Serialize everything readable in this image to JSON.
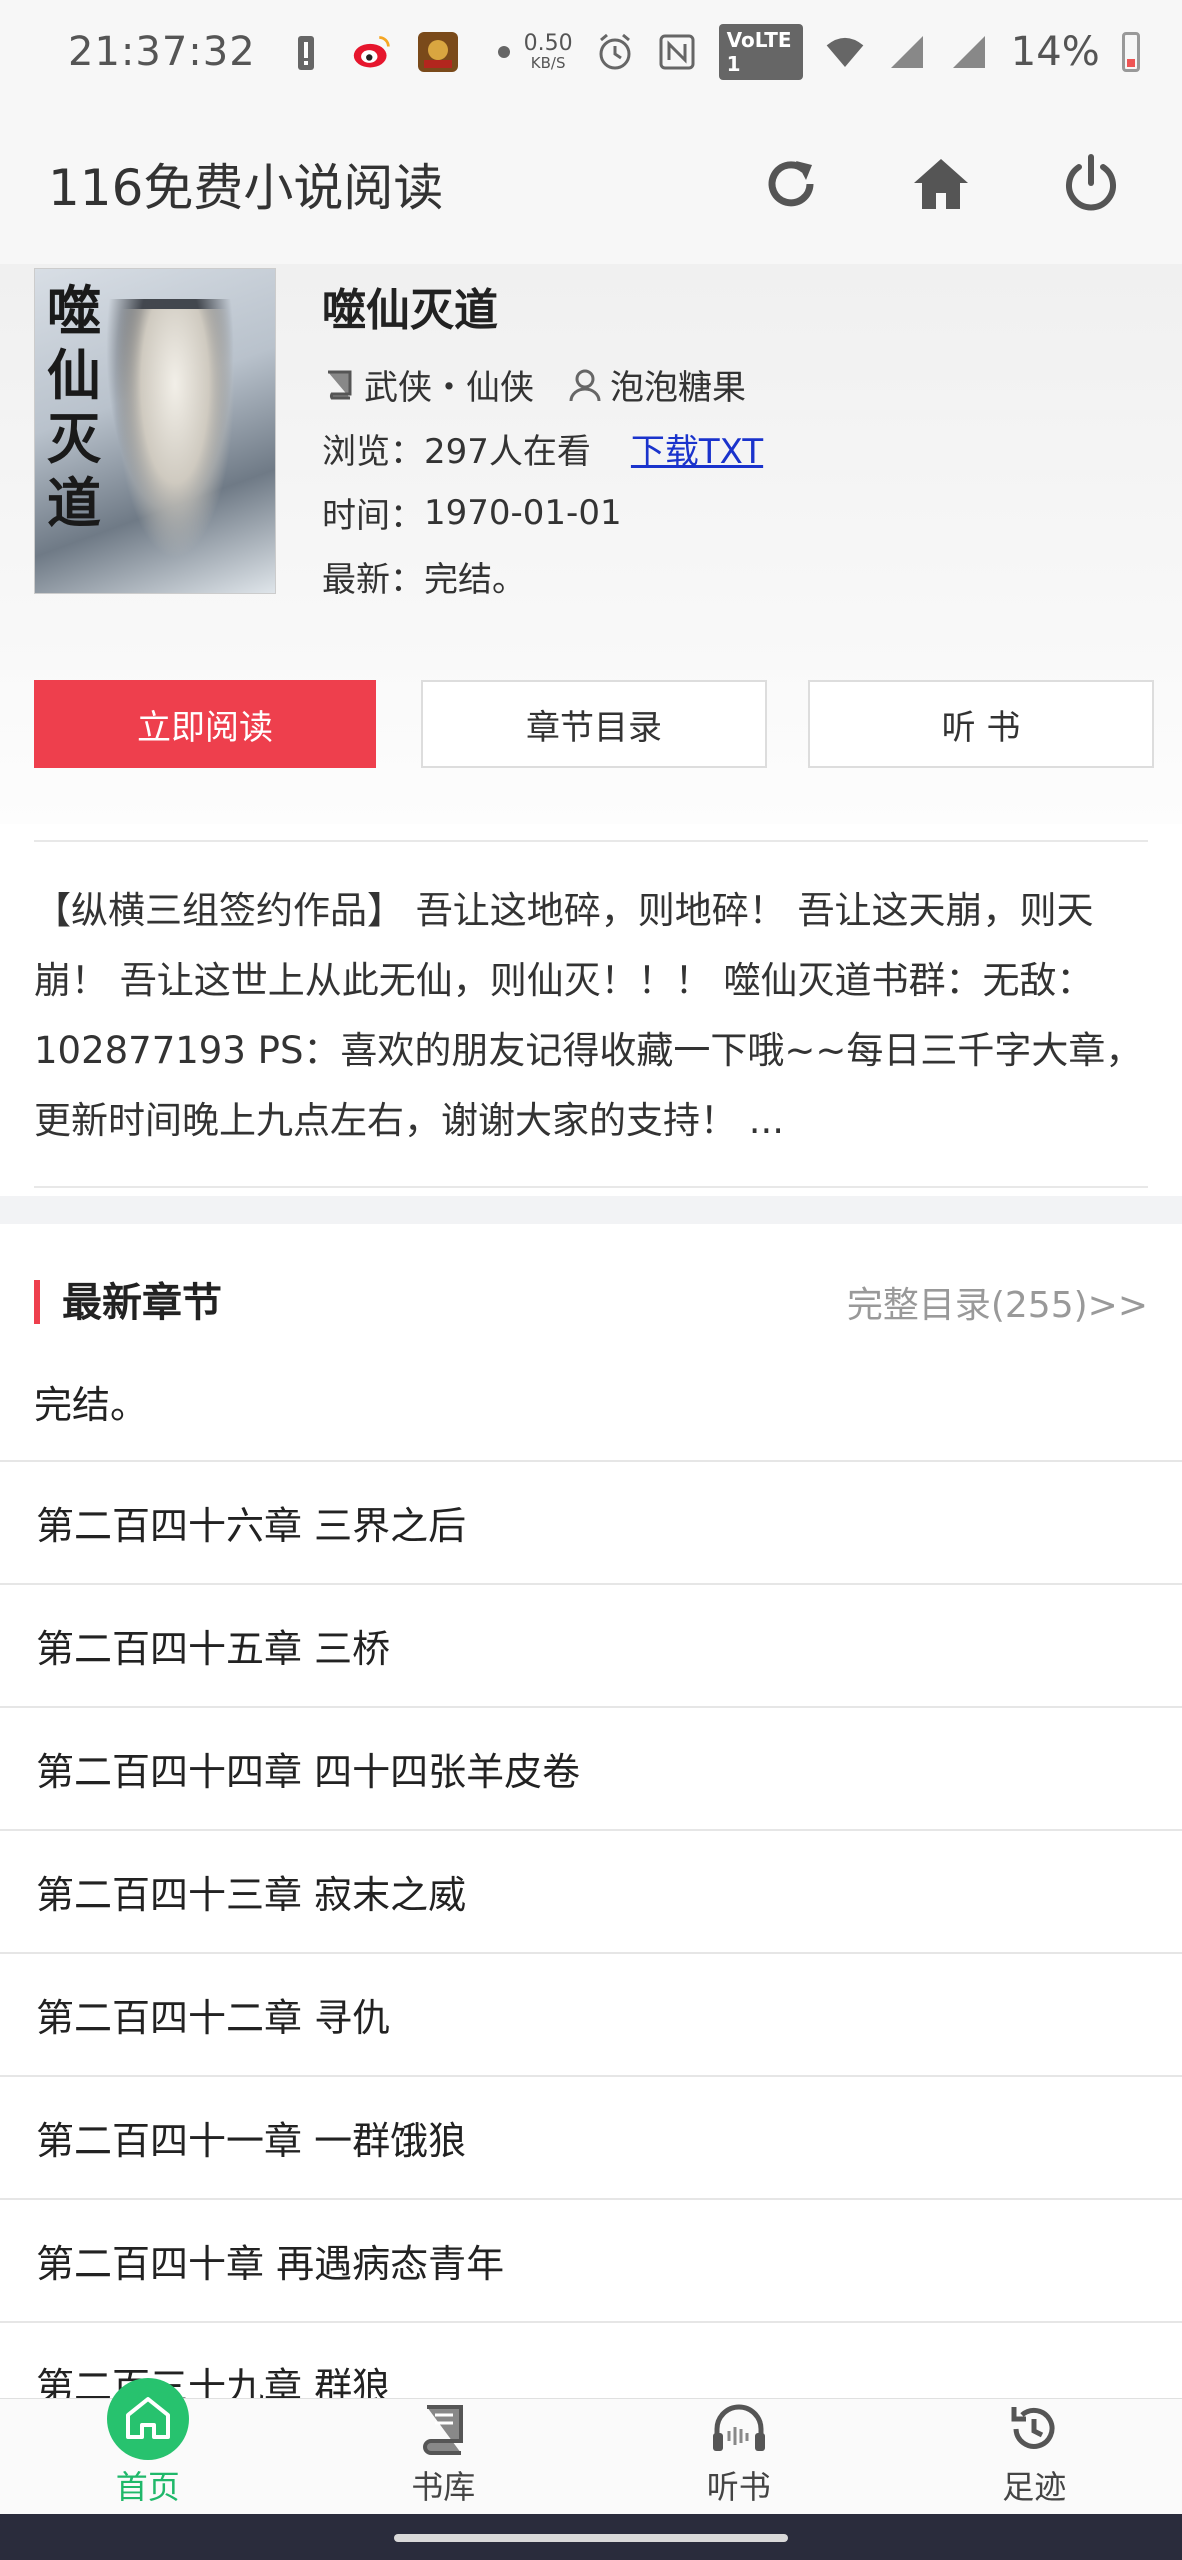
{
  "status_bar": {
    "time": "21:37:32",
    "net_speed_value": "0.50",
    "net_speed_unit": "KB/S",
    "volte": "VoLTE 1",
    "battery": "14%"
  },
  "header": {
    "title": "116免费小说阅读",
    "icons": [
      "refresh-icon",
      "home-icon",
      "power-icon"
    ]
  },
  "book": {
    "cover_title": "噬仙灭道",
    "title": "噬仙灭道",
    "category": "武侠・仙侠",
    "author": "泡泡糖果",
    "views_label": "浏览：",
    "views_value": "297人在看",
    "download_label": "下载TXT",
    "time_label": "时间：",
    "time_value": "1970-01-01",
    "latest_label": "最新：",
    "latest_value": "完结。"
  },
  "buttons": {
    "read_now": "立即阅读",
    "chapter_list": "章节目录",
    "listen": "听 书"
  },
  "intro": "【纵横三组签约作品】 吾让这地碎，则地碎！ 吾让这天崩，则天崩！ 吾让这世上从此无仙，则仙灭！！！ 噬仙灭道书群：无敌：102877193 PS：喜欢的朋友记得收藏一下哦~~每日三千字大章，更新时间晚上九点左右，谢谢大家的支持！ ...",
  "latest_section": {
    "title": "最新章节",
    "full_catalog": "完整目录(255)>>",
    "latest_entry": "完结。",
    "chapters": [
      "第二百四十六章 三界之后",
      "第二百四十五章 三桥",
      "第二百四十四章 四十四张羊皮卷",
      "第二百四十三章 寂末之威",
      "第二百四十二章 寻仇",
      "第二百四十一章 一群饿狼",
      "第二百四十章 再遇病态青年",
      "第二百三十九章 群狼"
    ]
  },
  "bottom_nav": {
    "items": [
      {
        "label": "首页",
        "icon": "home-icon",
        "active": true
      },
      {
        "label": "书库",
        "icon": "book-icon",
        "active": false
      },
      {
        "label": "听书",
        "icon": "headphones-icon",
        "active": false
      },
      {
        "label": "足迹",
        "icon": "history-icon",
        "active": false
      }
    ]
  },
  "colors": {
    "accent_red": "#ee3f4d",
    "accent_green": "#27c26e",
    "link_blue": "#1a33cc"
  }
}
